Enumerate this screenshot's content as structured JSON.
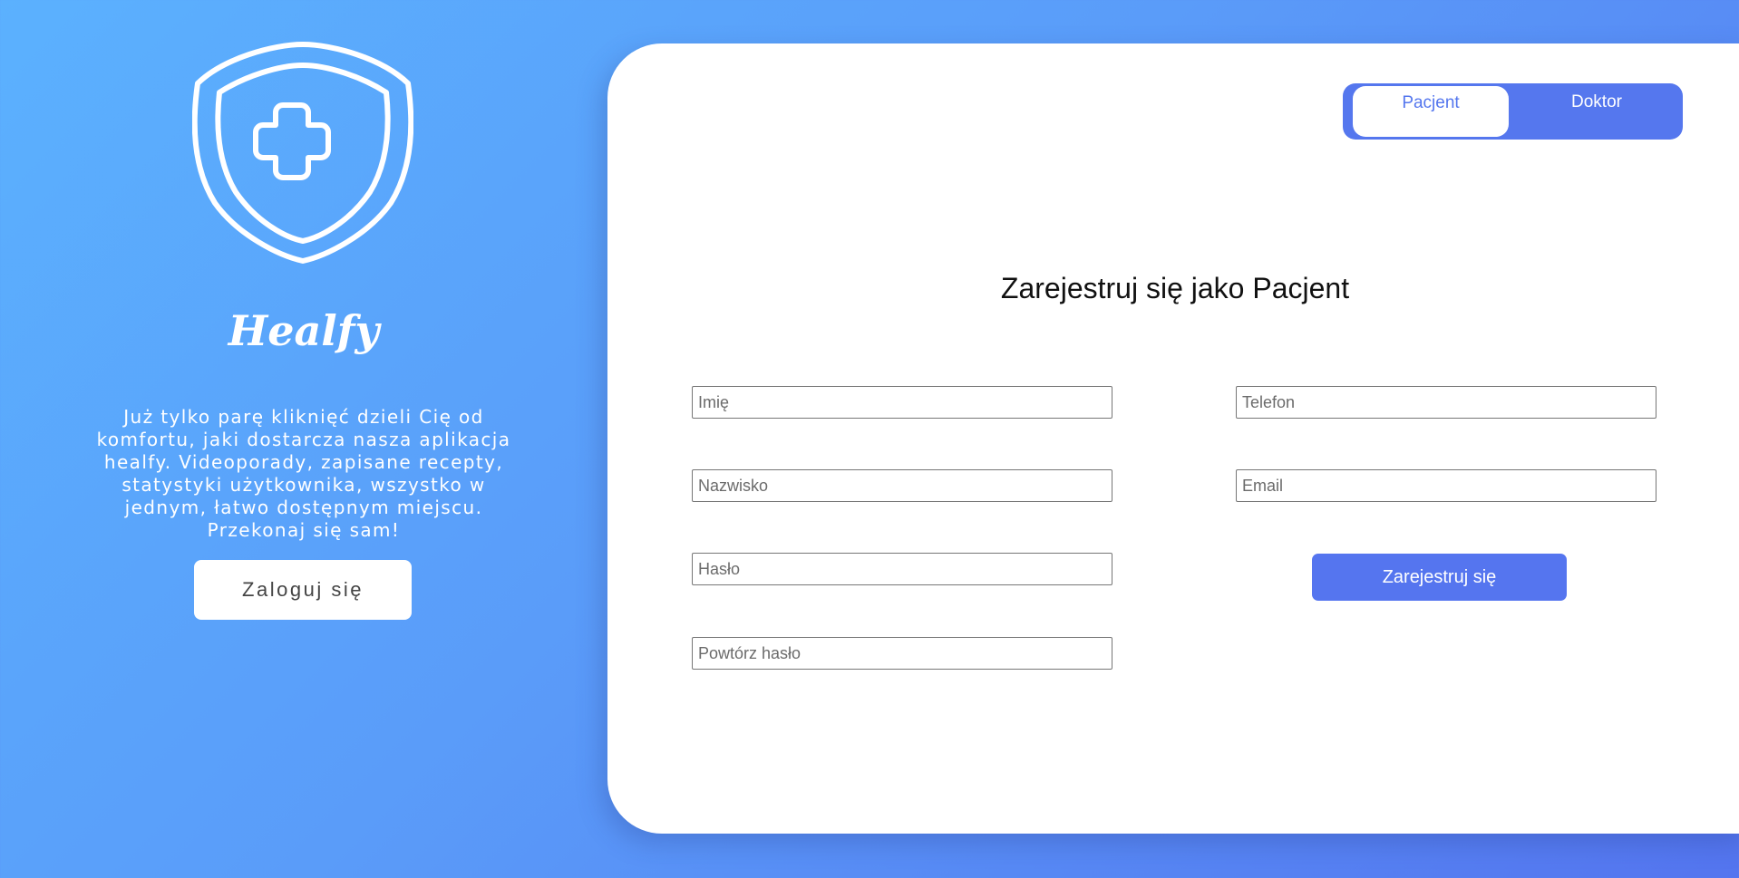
{
  "brand": {
    "name": "Healfy",
    "tagline": "Już tylko parę kliknięć dzieli Cię od komfortu, jaki dostarcza nasza aplikacja healfy. Videoporady, zapisane recepty, statystyki użytkownika, wszystko w jednym, łatwo dostępnym miejscu. Przekonaj się sam!",
    "logo_icon": "shield-medical-cross-icon"
  },
  "login": {
    "label": "Zaloguj się"
  },
  "role_toggle": {
    "options": [
      {
        "label": "Pacjent",
        "selected": true
      },
      {
        "label": "Doktor",
        "selected": false
      }
    ]
  },
  "form": {
    "title": "Zarejestruj się jako Pacjent",
    "fields": {
      "first_name": {
        "placeholder": "Imię",
        "value": ""
      },
      "last_name": {
        "placeholder": "Nazwisko",
        "value": ""
      },
      "password": {
        "placeholder": "Hasło",
        "value": ""
      },
      "repeat_password": {
        "placeholder": "Powtórz hasło",
        "value": ""
      },
      "phone": {
        "placeholder": "Telefon",
        "value": ""
      },
      "email": {
        "placeholder": "Email",
        "value": ""
      }
    },
    "submit_label": "Zarejestruj się"
  },
  "colors": {
    "background_start": "#5bb1fe",
    "background_end": "#5475ef",
    "accent": "#5577ee",
    "card": "#ffffff"
  }
}
